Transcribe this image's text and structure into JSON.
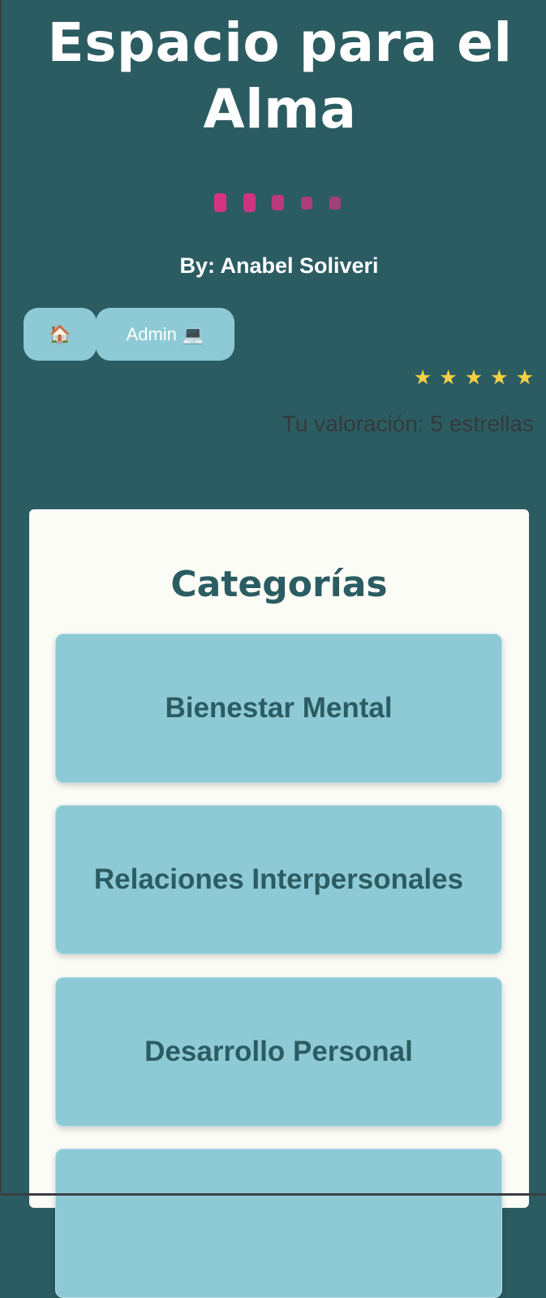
{
  "header": {
    "title": "Espacio para el Alma",
    "author": "By: Anabel Soliveri",
    "dot_color": "#d63384"
  },
  "nav": {
    "home_label": "🏠",
    "admin_label": "Admin 💻"
  },
  "rating": {
    "stars": [
      "★",
      "★",
      "★",
      "★",
      "★"
    ],
    "value": 5,
    "max": 5,
    "text": "Tu valoración: 5 estrellas",
    "star_color": "#f5d142"
  },
  "categories": {
    "title": "Categorías",
    "items": [
      {
        "label": "Bienestar Mental"
      },
      {
        "label": "Relaciones Interpersonales"
      },
      {
        "label": "Desarrollo Personal"
      },
      {
        "label": ""
      }
    ]
  },
  "colors": {
    "background": "#2b5c62",
    "accent": "#8ecad6",
    "card": "#fcfcf7"
  }
}
